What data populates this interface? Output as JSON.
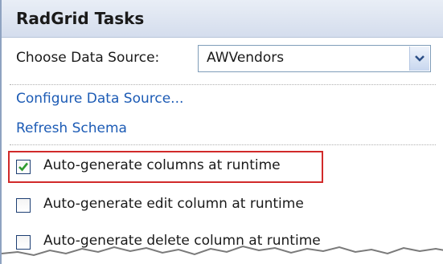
{
  "panel": {
    "title": "RadGrid Tasks"
  },
  "datasource": {
    "label": "Choose Data Source:",
    "selected": "AWVendors"
  },
  "links": {
    "configure": "Configure Data Source...",
    "refresh": "Refresh Schema"
  },
  "options": [
    {
      "label": "Auto-generate columns at runtime",
      "checked": true
    },
    {
      "label": "Auto-generate edit column at runtime",
      "checked": false
    },
    {
      "label": "Auto-generate delete column at runtime",
      "checked": false
    }
  ],
  "colors": {
    "link": "#1c5bb5",
    "highlight": "#d12a2a",
    "check": "#2e9b2e"
  },
  "icons": {
    "dropdown": "chevron-down-icon",
    "check": "checkmark-icon"
  }
}
